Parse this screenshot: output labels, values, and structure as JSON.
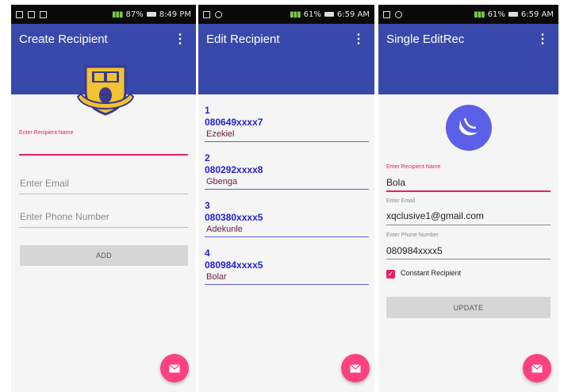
{
  "screens": [
    {
      "status": {
        "left_icons": [
          "image-icon",
          "sim-icon",
          "bbm-icon"
        ],
        "battery": "87%",
        "time": "8:49 PM"
      },
      "title": "Create Recipient",
      "form": {
        "name_label": "Enter Recipient Name",
        "email_placeholder": "Enter Email",
        "phone_placeholder": "Enter Phone Number",
        "add_button": "ADD"
      }
    },
    {
      "status": {
        "left_icons": [
          "image-icon",
          "settings-icon"
        ],
        "battery": "61%",
        "time": "6:59 AM"
      },
      "title": "Edit Recipient",
      "recipients": [
        {
          "index": "1",
          "phone": "080649xxxx7",
          "name": "Ezekiel"
        },
        {
          "index": "2",
          "phone": "080292xxxx8",
          "name": "Gbenga"
        },
        {
          "index": "3",
          "phone": "080380xxxx5",
          "name": "Adekunle"
        },
        {
          "index": "4",
          "phone": "080984xxxx5",
          "name": "Bolar"
        }
      ]
    },
    {
      "status": {
        "left_icons": [
          "image-icon",
          "settings-icon"
        ],
        "battery": "61%",
        "time": "6:59 AM"
      },
      "title": "Single EditRec",
      "form": {
        "name_label": "Enter Recipient Name",
        "name_value": "Bola",
        "email_label": "Enter Email",
        "email_value": "xqclusive1@gmail.com",
        "phone_label": "Enter Phone Number",
        "phone_value": "080984xxxx5",
        "checkbox_label": "Constant Recipient",
        "checkbox_checked": true,
        "update_button": "UPDATE"
      }
    }
  ],
  "colors": {
    "primary": "#3949ab",
    "accent": "#ff4081",
    "list_text": "#2321d6"
  },
  "icons": {
    "fab": "mail-icon",
    "menu": "overflow-menu-icon",
    "avatar": "app-logo-icon"
  }
}
